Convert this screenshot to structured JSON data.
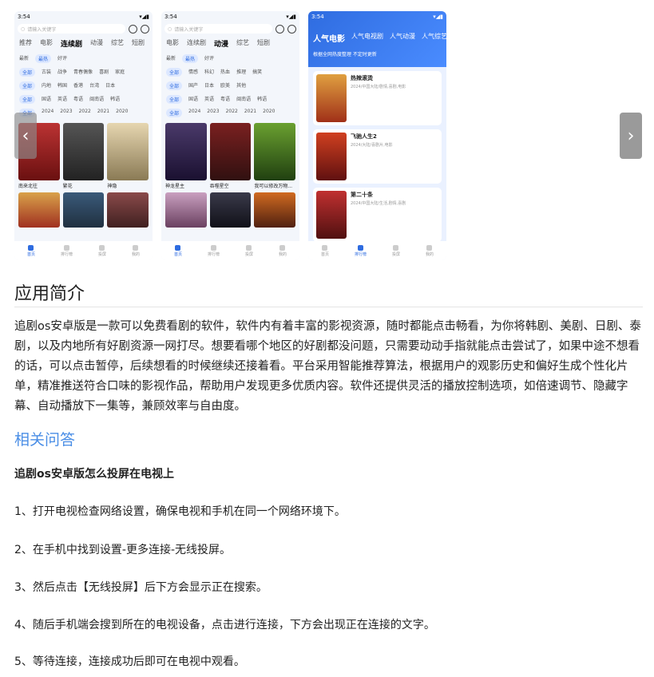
{
  "gallery": {
    "shot1": {
      "time": "3:54",
      "search_placeholder": "请输入关键字",
      "tabs": [
        "推荐",
        "电影",
        "连续剧",
        "动漫",
        "综艺",
        "短剧"
      ],
      "sort": [
        "最新",
        "最热",
        "好评"
      ],
      "row1": [
        "全部",
        "古装",
        "战争",
        "青春偶像",
        "喜剧",
        "家庭"
      ],
      "row2": [
        "全部",
        "内地",
        "韩国",
        "香港",
        "台湾",
        "日本"
      ],
      "row3": [
        "全部",
        "国语",
        "英语",
        "粤语",
        "闽南语",
        "韩语"
      ],
      "row4": [
        "全部",
        "2024",
        "2023",
        "2022",
        "2021",
        "2020"
      ],
      "captions": [
        "南来北往",
        "繁花",
        "神隐"
      ]
    },
    "shot2": {
      "time": "3:54",
      "tabs": [
        "电影",
        "连续剧",
        "动漫",
        "综艺",
        "短剧"
      ],
      "sort": [
        "最新",
        "最热",
        "好评"
      ],
      "row1": [
        "全部",
        "情感",
        "科幻",
        "热血",
        "推理",
        "搞笑"
      ],
      "row2": [
        "全部",
        "国产",
        "日本",
        "欧美",
        "其他"
      ],
      "row3": [
        "全部",
        "国语",
        "英语",
        "粤语",
        "闽南语",
        "韩语"
      ],
      "row4": [
        "全部",
        "2024",
        "2023",
        "2022",
        "2021",
        "2020"
      ],
      "captions": [
        "神龙星主",
        "吞噬星空",
        "我可以修改万物..."
      ]
    },
    "shot3": {
      "time": "3:54",
      "tabs": [
        "人气电影",
        "人气电视剧",
        "人气动漫",
        "人气综艺"
      ],
      "subtitle": "根据全网热度整理 不定时更新",
      "cards": [
        {
          "title": "热辣滚烫",
          "meta": "2024/中国大陆/剧情,喜剧,电影"
        },
        {
          "title": "飞驰人生2",
          "meta": "2024/大陆/喜剧片,电影"
        },
        {
          "title": "第二十条",
          "meta": "2024/中国大陆/生活,剧情,喜剧"
        }
      ]
    },
    "nav": [
      "首页",
      "排行榜",
      "投屏",
      "我的"
    ]
  },
  "intro": {
    "heading": "应用简介",
    "body": "追剧os安卓版是一款可以免费看剧的软件，软件内有着丰富的影视资源，随时都能点击畅看，为你将韩剧、美剧、日剧、泰剧，以及内地所有好剧资源一网打尽。想要看哪个地区的好剧都没问题，只需要动动手指就能点击尝试了，如果中途不想看的话，可以点击暂停，后续想看的时候继续还接着看。平台采用智能推荐算法，根据用户的观影历史和偏好生成个性化片单，精准推送符合口味的影视作品，帮助用户发现更多优质内容。软件还提供灵活的播放控制选项，如倍速调节、隐藏字幕、自动播放下一集等，兼顾效率与自由度。"
  },
  "qa": {
    "heading": "相关问答",
    "question": "追剧os安卓版怎么投屏在电视上",
    "steps": [
      "1、打开电视检查网络设置，确保电视和手机在同一个网络环境下。",
      "2、在手机中找到设置-更多连接-无线投屏。",
      "3、然后点击【无线投屏】后下方会显示正在搜索。",
      "4、随后手机端会搜到所在的电视设备，点击进行连接，下方会出现正在连接的文字。",
      "5、等待连接，连接成功后即可在电视中观看。"
    ]
  },
  "colors": {
    "accent": "#2f6ce0",
    "link": "#4a8ee6"
  }
}
